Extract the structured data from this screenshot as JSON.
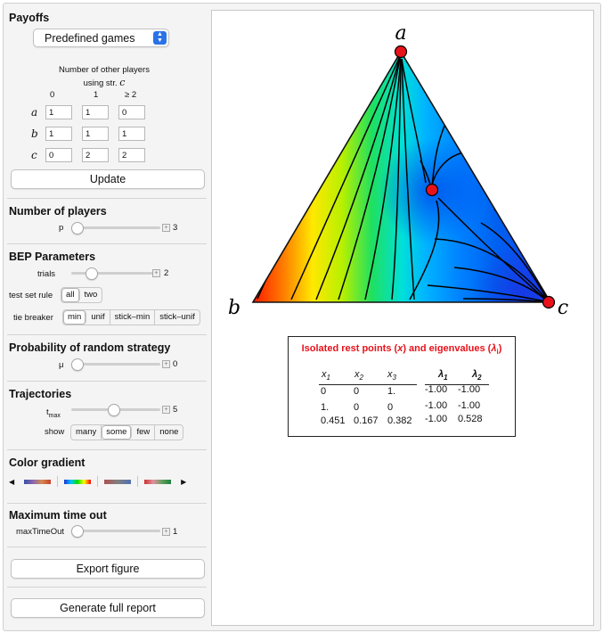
{
  "payoffs": {
    "title": "Payoffs",
    "game_select": "Predefined games",
    "header_line1": "Number of other players",
    "header_line2": "using str.",
    "header_strategy": "c",
    "columns": [
      "0",
      "1",
      "≥ 2"
    ],
    "rows": [
      {
        "label": "a",
        "values": [
          "1",
          "1",
          "0"
        ]
      },
      {
        "label": "b",
        "values": [
          "1",
          "1",
          "1"
        ]
      },
      {
        "label": "c",
        "values": [
          "0",
          "2",
          "2"
        ]
      }
    ],
    "update_label": "Update"
  },
  "players": {
    "title": "Number of players",
    "param": "p",
    "value": "3",
    "level": 0.0
  },
  "bep": {
    "title": "BEP Parameters",
    "trials_label": "trials",
    "trials_value": "2",
    "trials_level": 0.18,
    "test_set_label": "test set rule",
    "test_set_options": [
      "all",
      "two"
    ],
    "test_set_selected": 0,
    "tie_label": "tie breaker",
    "tie_options": [
      "min",
      "unif",
      "stick–min",
      "stick–unif"
    ],
    "tie_selected": 0
  },
  "random": {
    "title": "Probability of random strategy",
    "param": "μ",
    "value": "0",
    "level": 0.0
  },
  "trajectories": {
    "title": "Trajectories",
    "tmax_label": "t",
    "tmax_sub": "max",
    "tmax_value": "5",
    "tmax_level": 0.47,
    "show_label": "show",
    "show_options": [
      "many",
      "some",
      "few",
      "none"
    ],
    "show_selected": 1
  },
  "gradient": {
    "title": "Color gradient"
  },
  "timeout": {
    "title": "Maximum time out",
    "param": "maxTimeOut",
    "value": "1",
    "level": 0.0
  },
  "export_label": "Export figure",
  "report_label": "Generate full report",
  "simplex": {
    "vertex_top": "a",
    "vertex_left": "b",
    "vertex_right": "c"
  },
  "rest_points": {
    "title_prefix": "Isolated rest points (",
    "title_x": "x",
    "title_mid": ") and eigenvalues (",
    "title_lambda": "λ",
    "title_sub": "i",
    "title_suffix": ")",
    "col_x": [
      "x",
      "x",
      "x"
    ],
    "col_x_sub": [
      "1",
      "2",
      "3"
    ],
    "col_l": [
      "λ",
      "λ"
    ],
    "col_l_sub": [
      "1",
      "2"
    ],
    "rows": [
      [
        "0",
        "0",
        "1.",
        "-1.00",
        "-1.00"
      ],
      [
        "1.",
        "0",
        "0",
        "-1.00",
        "-1.00"
      ],
      [
        "0.451",
        "0.167",
        "0.382",
        "-1.00",
        "0.528"
      ]
    ]
  },
  "colors": {
    "rest_point": "#e8121b",
    "title_red": "#e8121b"
  }
}
